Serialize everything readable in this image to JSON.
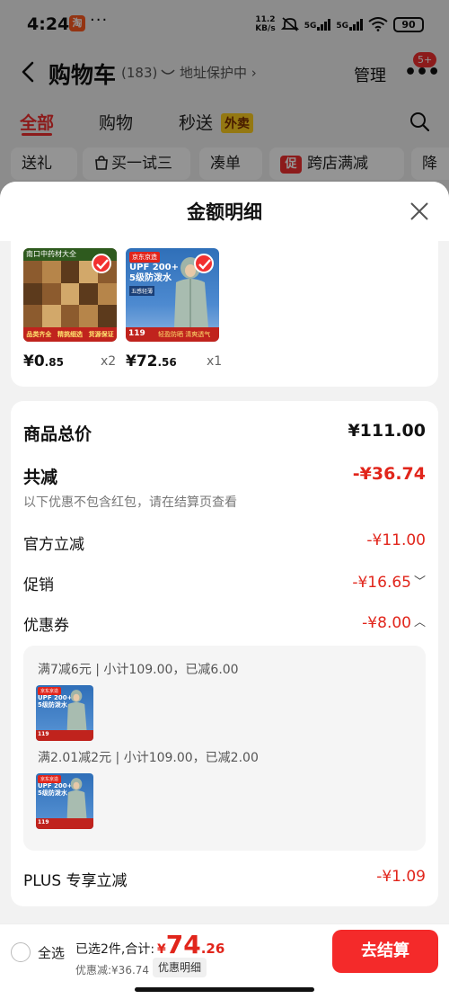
{
  "status_bar": {
    "time": "4:24",
    "app_badge": "淘",
    "dots": "···",
    "net_speed_value": "11.2",
    "net_speed_unit": "KB/s",
    "signal_1": "5G",
    "signal_2": "5G",
    "battery": "90"
  },
  "cart_header": {
    "title": "购物车",
    "count": "(183)",
    "address_protect": "地址保护中 ›",
    "manage": "管理",
    "more_badge": "5+"
  },
  "tabs": {
    "all": "全部",
    "shopping": "购物",
    "fast_delivery": "秒送",
    "takeout_tag": "外卖"
  },
  "filters": {
    "gift": "送礼",
    "try": "买一试三",
    "bundle": "凑单",
    "promo_mark": "促",
    "cross_store": "跨店满减",
    "drop": "降"
  },
  "sheet": {
    "title": "金额明细"
  },
  "items": [
    {
      "price_int": "¥0",
      "price_dec": ".85",
      "qty": "x2",
      "thumb_header": "南口中药材大全",
      "thumb_tags": [
        "品类齐全",
        "精挑细选",
        "货源保证"
      ]
    },
    {
      "price_int": "¥72",
      "price_dec": ".56",
      "qty": "x1",
      "jd_tag": "京东京造",
      "upf_line1": "UPF 200+",
      "upf_line2": "5级防泼水",
      "mini_tag": "五感轻薄",
      "strip_price": "119",
      "strip_text": "轻盈防晒 清爽透气"
    }
  ],
  "summary": {
    "total_label": "商品总价",
    "total_value": "¥111.00",
    "discount_label": "共减",
    "discount_value": "-¥36.74",
    "discount_note": "以下优惠不包含红包，请在结算页查看",
    "official_label": "官方立减",
    "official_value": "-¥11.00",
    "promo_label": "促销",
    "promo_value": "-¥16.65",
    "coupon_label": "优惠券",
    "coupon_value": "-¥8.00",
    "coupon_rules": [
      "满7减6元 | 小计109.00，已减6.00",
      "满2.01减2元 | 小计109.00，已减2.00"
    ],
    "plus_label": "PLUS 专享立减",
    "plus_value": "-¥1.09"
  },
  "bottom_bar": {
    "select_all": "全选",
    "selected_text": "已选2件,合计:",
    "price_currency": "¥",
    "price_int": "74",
    "price_dec": ".26",
    "saved_text": "优惠减:¥36.74",
    "detail_button": "优惠明细",
    "checkout_button": "去结算"
  },
  "colors": {
    "accent_red": "#e1251b",
    "checkout_red": "#f42a2a",
    "takeout_yellow": "#ffcf1f"
  }
}
